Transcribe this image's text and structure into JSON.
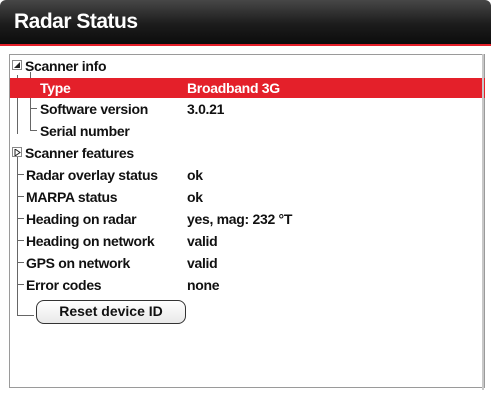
{
  "window": {
    "title": "Radar Status"
  },
  "tree": {
    "scanner_info": {
      "label": "Scanner info",
      "children": [
        {
          "label": "Type",
          "value": "Broadband 3G"
        },
        {
          "label": "Software version",
          "value": "3.0.21"
        },
        {
          "label": "Serial number",
          "value": ""
        }
      ]
    },
    "scanner_features": {
      "label": "Scanner features"
    },
    "items": [
      {
        "label": "Radar overlay status",
        "value": "ok"
      },
      {
        "label": "MARPA status",
        "value": "ok"
      },
      {
        "label": "Heading on radar",
        "value": "yes, mag: 232 °T"
      },
      {
        "label": "Heading on network",
        "value": "valid"
      },
      {
        "label": "GPS on network",
        "value": "valid"
      },
      {
        "label": "Error codes",
        "value": "none"
      }
    ]
  },
  "reset_button": {
    "label": "Reset device ID"
  },
  "colors": {
    "selection": "#e4202a",
    "titlebar": "#1c1c1c",
    "text": "#111111"
  }
}
